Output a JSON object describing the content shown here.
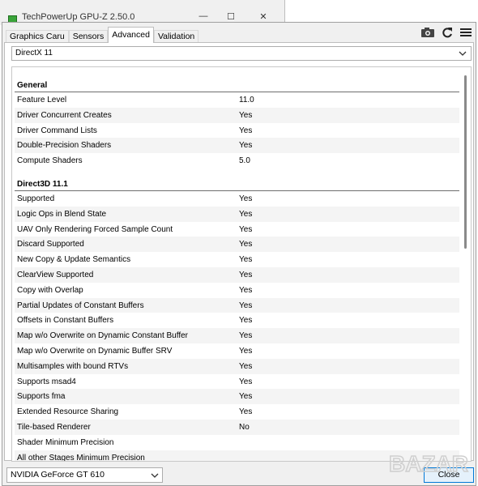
{
  "window": {
    "title": "TechPowerUp GPU-Z 2.50.0",
    "minimize_glyph": "—",
    "maximize_glyph": "☐",
    "close_glyph": "✕"
  },
  "tabs": [
    {
      "label": "Graphics Caru",
      "active": false
    },
    {
      "label": "Sensors",
      "active": false
    },
    {
      "label": "Advanced",
      "active": true
    },
    {
      "label": "Validation",
      "active": false
    }
  ],
  "toolbar": {
    "icons": [
      "camera-icon",
      "refresh-icon",
      "menu-icon"
    ]
  },
  "api_dropdown": {
    "selected": "DirectX 11"
  },
  "sections": [
    {
      "title": "General",
      "rows": [
        {
          "key": "Feature Level",
          "value": "11.0"
        },
        {
          "key": "Driver Concurrent Creates",
          "value": "Yes"
        },
        {
          "key": "Driver Command Lists",
          "value": "Yes"
        },
        {
          "key": "Double-Precision Shaders",
          "value": "Yes"
        },
        {
          "key": "Compute Shaders",
          "value": "5.0"
        }
      ]
    },
    {
      "title": "Direct3D 11.1",
      "rows": [
        {
          "key": "Supported",
          "value": "Yes"
        },
        {
          "key": "Logic Ops in Blend State",
          "value": "Yes"
        },
        {
          "key": "UAV Only Rendering Forced Sample Count",
          "value": "Yes"
        },
        {
          "key": "Discard Supported",
          "value": "Yes"
        },
        {
          "key": "New Copy & Update Semantics",
          "value": "Yes"
        },
        {
          "key": "ClearView Supported",
          "value": "Yes"
        },
        {
          "key": "Copy with Overlap",
          "value": "Yes"
        },
        {
          "key": "Partial Updates of Constant Buffers",
          "value": "Yes"
        },
        {
          "key": "Offsets in Constant Buffers",
          "value": "Yes"
        },
        {
          "key": "Map w/o Overwrite on Dynamic Constant Buffer",
          "value": "Yes"
        },
        {
          "key": "Map w/o Overwrite on Dynamic Buffer SRV",
          "value": "Yes"
        },
        {
          "key": "Multisamples with bound RTVs",
          "value": "Yes"
        },
        {
          "key": "Supports msad4",
          "value": "Yes"
        },
        {
          "key": "Supports fma",
          "value": "Yes"
        },
        {
          "key": "Extended Resource Sharing",
          "value": "Yes"
        },
        {
          "key": "Tile-based Renderer",
          "value": "No"
        },
        {
          "key": "Shader Minimum Precision",
          "value": ""
        },
        {
          "key": "All other Stages Minimum Precision",
          "value": ""
        }
      ]
    }
  ],
  "gpu_dropdown": {
    "selected": "NVIDIA GeForce GT 610"
  },
  "close_button": {
    "label": "Close"
  },
  "watermark": {
    "text": "BAZAR"
  },
  "colors": {
    "accent": "#0078d7",
    "button_bg": "#e5f1fb"
  }
}
